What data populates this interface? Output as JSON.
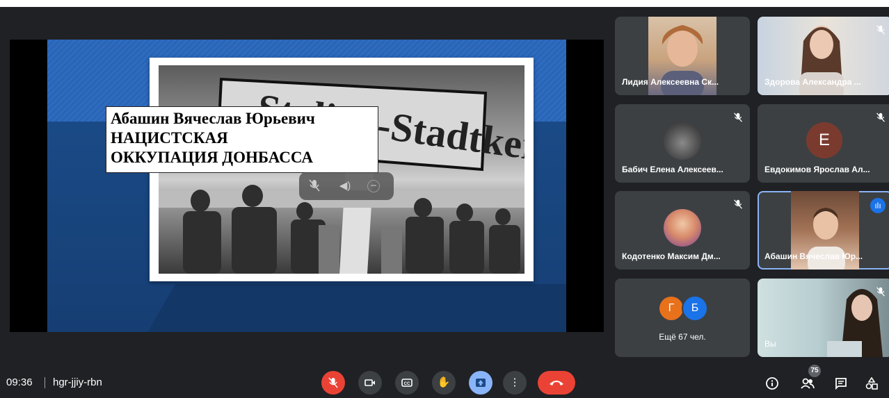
{
  "presentation": {
    "title_lines": [
      "Абашин Вячеслав Юрьевич",
      "НАЦИСТСКАЯ",
      "ОККУПАЦИЯ ДОНБАССА"
    ]
  },
  "participants": [
    {
      "name": "Лидия Алексеевна Ск...",
      "icon": "video-feed"
    },
    {
      "name": "Здорова Александра ...",
      "icon": "video-feed",
      "muted": true
    },
    {
      "name": "Бабич Елена Алексеев...",
      "icon": "wolf-avatar",
      "muted": true
    },
    {
      "name": "Евдокимов Ярослав Ал...",
      "avatar_letter": "Е",
      "muted": true
    },
    {
      "name": "Кодотенко Максим Дм...",
      "icon": "cartoon-avatar",
      "muted": true
    },
    {
      "name": "Абашин Вячеслав Юр...",
      "icon": "video-feed",
      "speaking": true
    }
  ],
  "more_tile": {
    "letters": [
      "Г",
      "Б"
    ],
    "label": "Ещё 67 чел."
  },
  "self_tile": {
    "label": "Вы",
    "muted": true
  },
  "bottom_bar": {
    "time": "09:36",
    "meeting_code": "hgr-jjiy-rbn",
    "people_count": "75",
    "controls": [
      "mic-off-icon",
      "camera-icon",
      "captions-icon",
      "raise-hand-icon",
      "present-icon",
      "more-options-icon",
      "end-call-icon"
    ],
    "right_icons": [
      "info-icon",
      "people-icon",
      "chat-icon",
      "activities-icon"
    ]
  },
  "colors": {
    "background": "#202124",
    "tile": "#3c4043",
    "end_call": "#ea4335",
    "mic_off": "#ea4335",
    "present": "#8ab4f8",
    "accent_blue": "#1a73e8"
  }
}
